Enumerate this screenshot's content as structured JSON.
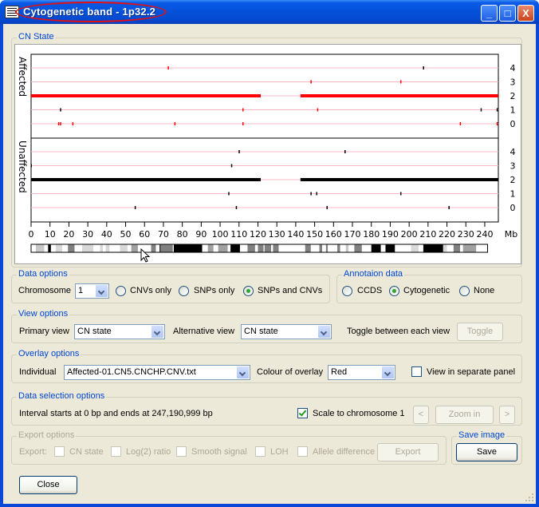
{
  "window": {
    "title": "Cytogenetic band - 1p32.2",
    "controls": {
      "minimize": "_",
      "maximize": "□",
      "close": "X"
    }
  },
  "cn_state_group": {
    "legend": "CN State",
    "panel_labels": [
      "Affected",
      "Unaffected"
    ],
    "level_labels": [
      "4",
      "3",
      "2",
      "1",
      "0"
    ],
    "x_unit": "Mb"
  },
  "chart_data": {
    "type": "scatter",
    "title": "CN State",
    "xlabel": "Mb",
    "ylabel": "CN state",
    "xlim": [
      0,
      247.19
    ],
    "ylim": [
      0,
      4
    ],
    "x_ticks": [
      0,
      10,
      20,
      30,
      40,
      50,
      60,
      70,
      80,
      90,
      100,
      110,
      120,
      130,
      140,
      150,
      160,
      170,
      180,
      190,
      200,
      210,
      220,
      230,
      240
    ],
    "y_ticks": [
      0,
      1,
      2,
      3,
      4
    ],
    "grid": true,
    "panels": [
      {
        "name": "Affected",
        "color": "#ff0000",
        "segments": [
          {
            "state": 2,
            "start": 0,
            "end": 121.5
          },
          {
            "state": 2,
            "start": 142.5,
            "end": 247.19
          }
        ],
        "points": [
          {
            "x": 72.5,
            "state": 4,
            "color": "#ff0000"
          },
          {
            "x": 207.5,
            "state": 4,
            "color": "#000000"
          },
          {
            "x": 148,
            "state": 3,
            "color": "#ff0000"
          },
          {
            "x": 195.5,
            "state": 3,
            "color": "#ff0000"
          },
          {
            "x": 15.5,
            "state": 1,
            "color": "#000000"
          },
          {
            "x": 112,
            "state": 1,
            "color": "#ff0000"
          },
          {
            "x": 151.5,
            "state": 1,
            "color": "#ff0000"
          },
          {
            "x": 238,
            "state": 1,
            "color": "#000000"
          },
          {
            "x": 246.5,
            "state": 1,
            "color": "#000000"
          },
          {
            "x": 14.5,
            "state": 0,
            "color": "#ff0000"
          },
          {
            "x": 15.5,
            "state": 0,
            "color": "#ff0000"
          },
          {
            "x": 22,
            "state": 0,
            "color": "#ff0000"
          },
          {
            "x": 76,
            "state": 0,
            "color": "#ff0000"
          },
          {
            "x": 112,
            "state": 0,
            "color": "#ff0000"
          },
          {
            "x": 227,
            "state": 0,
            "color": "#ff0000"
          },
          {
            "x": 246.5,
            "state": 0,
            "color": "#ff0000"
          }
        ]
      },
      {
        "name": "Unaffected",
        "color": "#000000",
        "segments": [
          {
            "state": 2,
            "start": 0,
            "end": 121.5
          },
          {
            "state": 2,
            "start": 142.5,
            "end": 247.19
          }
        ],
        "points": [
          {
            "x": 110,
            "state": 4,
            "color": "#000000"
          },
          {
            "x": 166,
            "state": 4,
            "color": "#000000"
          },
          {
            "x": 0,
            "state": 3,
            "color": "#000000"
          },
          {
            "x": 106,
            "state": 3,
            "color": "#000000"
          },
          {
            "x": 104.5,
            "state": 1,
            "color": "#000000"
          },
          {
            "x": 148,
            "state": 1,
            "color": "#000000"
          },
          {
            "x": 151,
            "state": 1,
            "color": "#000000"
          },
          {
            "x": 195.5,
            "state": 1,
            "color": "#000000"
          },
          {
            "x": 55,
            "state": 0,
            "color": "#000000"
          },
          {
            "x": 108.5,
            "state": 0,
            "color": "#000000"
          },
          {
            "x": 156.5,
            "state": 0,
            "color": "#000000"
          },
          {
            "x": 221,
            "state": 0,
            "color": "#000000"
          }
        ]
      }
    ],
    "ideogram_bands": [
      {
        "start": 0,
        "end": 2.5,
        "color": "#ffffff"
      },
      {
        "start": 2.5,
        "end": 7,
        "color": "#c8c8c8"
      },
      {
        "start": 7,
        "end": 9,
        "color": "#ffffff"
      },
      {
        "start": 9,
        "end": 10.5,
        "color": "#000000"
      },
      {
        "start": 10.5,
        "end": 13,
        "color": "#ffffff"
      },
      {
        "start": 13,
        "end": 16.5,
        "color": "#d8d8d8"
      },
      {
        "start": 16.5,
        "end": 19.5,
        "color": "#ffffff"
      },
      {
        "start": 19.5,
        "end": 23,
        "color": "#808080"
      },
      {
        "start": 23,
        "end": 27,
        "color": "#ffffff"
      },
      {
        "start": 27,
        "end": 33,
        "color": "#d8d8d8"
      },
      {
        "start": 33,
        "end": 36.5,
        "color": "#ffffff"
      },
      {
        "start": 36.5,
        "end": 38,
        "color": "#d8d8d8"
      },
      {
        "start": 38,
        "end": 39.5,
        "color": "#ffffff"
      },
      {
        "start": 39.5,
        "end": 41.5,
        "color": "#d8d8d8"
      },
      {
        "start": 41.5,
        "end": 47,
        "color": "#ffffff"
      },
      {
        "start": 47,
        "end": 51,
        "color": "#d8d8d8"
      },
      {
        "start": 51,
        "end": 53,
        "color": "#ffffff"
      },
      {
        "start": 53,
        "end": 56.5,
        "color": "#a0a0a0"
      },
      {
        "start": 56.5,
        "end": 63.5,
        "color": "#ffffff"
      },
      {
        "start": 63.5,
        "end": 66,
        "color": "#808080"
      },
      {
        "start": 66,
        "end": 68,
        "color": "#ffffff"
      },
      {
        "start": 68,
        "end": 68.5,
        "color": "#000000"
      },
      {
        "start": 68.5,
        "end": 75,
        "color": "#808080"
      },
      {
        "start": 75,
        "end": 75.5,
        "color": "#ffffff"
      },
      {
        "start": 75.5,
        "end": 90.5,
        "color": "#000000"
      },
      {
        "start": 90.5,
        "end": 93.5,
        "color": "#ffffff"
      },
      {
        "start": 93.5,
        "end": 96.5,
        "color": "#a0a0a0"
      },
      {
        "start": 96.5,
        "end": 99,
        "color": "#ffffff"
      },
      {
        "start": 99,
        "end": 104,
        "color": "#a0a0a0"
      },
      {
        "start": 104,
        "end": 105.5,
        "color": "#ffffff"
      },
      {
        "start": 105.5,
        "end": 110.5,
        "color": "#000000"
      },
      {
        "start": 110.5,
        "end": 114.5,
        "color": "#ffffff"
      },
      {
        "start": 114.5,
        "end": 118.5,
        "color": "#808080"
      },
      {
        "start": 118.5,
        "end": 120,
        "color": "#ffffff"
      },
      {
        "start": 120,
        "end": 123,
        "color": "#808080"
      },
      {
        "start": 123,
        "end": 123.5,
        "color": "#ffffff"
      },
      {
        "start": 123.5,
        "end": 127,
        "color": "#808080"
      },
      {
        "start": 127,
        "end": 128,
        "color": "#ffffff"
      },
      {
        "start": 128,
        "end": 131,
        "color": "#808080"
      },
      {
        "start": 131,
        "end": 144,
        "color": "#ffffff"
      },
      {
        "start": 144,
        "end": 145,
        "color": "#ffffff"
      },
      {
        "start": 145,
        "end": 148,
        "color": "#808080"
      },
      {
        "start": 148,
        "end": 152.5,
        "color": "#ffffff"
      },
      {
        "start": 152.5,
        "end": 154,
        "color": "#808080"
      },
      {
        "start": 154,
        "end": 156,
        "color": "#ffffff"
      },
      {
        "start": 156,
        "end": 157,
        "color": "#808080"
      },
      {
        "start": 157,
        "end": 162,
        "color": "#ffffff"
      },
      {
        "start": 162,
        "end": 163.5,
        "color": "#808080"
      },
      {
        "start": 163.5,
        "end": 166.5,
        "color": "#ffffff"
      },
      {
        "start": 166.5,
        "end": 168,
        "color": "#c8c8c8"
      },
      {
        "start": 168,
        "end": 171,
        "color": "#ffffff"
      },
      {
        "start": 171,
        "end": 175,
        "color": "#808080"
      },
      {
        "start": 175,
        "end": 180,
        "color": "#ffffff"
      },
      {
        "start": 180,
        "end": 185,
        "color": "#000000"
      },
      {
        "start": 185,
        "end": 187.5,
        "color": "#ffffff"
      },
      {
        "start": 187.5,
        "end": 192.5,
        "color": "#000000"
      },
      {
        "start": 192.5,
        "end": 201,
        "color": "#ffffff"
      },
      {
        "start": 201,
        "end": 205,
        "color": "#d8d8d8"
      },
      {
        "start": 205,
        "end": 207.5,
        "color": "#ffffff"
      },
      {
        "start": 207.5,
        "end": 218,
        "color": "#000000"
      },
      {
        "start": 218,
        "end": 220,
        "color": "#d8d8d8"
      },
      {
        "start": 220,
        "end": 223.5,
        "color": "#ffffff"
      },
      {
        "start": 223.5,
        "end": 227,
        "color": "#808080"
      },
      {
        "start": 227,
        "end": 228.5,
        "color": "#ffffff"
      },
      {
        "start": 228.5,
        "end": 235.5,
        "color": "#a0a0a0"
      },
      {
        "start": 235.5,
        "end": 241.5,
        "color": "#ffffff"
      }
    ]
  },
  "data_options": {
    "legend": "Data options",
    "chromosome_label": "Chromosome",
    "chromosome_value": "1",
    "radios": [
      {
        "label": "CNVs only",
        "checked": false
      },
      {
        "label": "SNPs only",
        "checked": false
      },
      {
        "label": "SNPs and CNVs",
        "checked": true
      }
    ]
  },
  "annotation_data": {
    "legend": "Annotaion data",
    "radios": [
      {
        "label": "CCDS",
        "checked": false
      },
      {
        "label": "Cytogenetic",
        "checked": true
      },
      {
        "label": "None",
        "checked": false
      }
    ]
  },
  "view_options": {
    "legend": "View options",
    "primary_label": "Primary view",
    "primary_value": "CN state",
    "alternative_label": "Alternative view",
    "alternative_value": "CN state",
    "toggle_label": "Toggle between each view",
    "toggle_button": "Toggle"
  },
  "overlay_options": {
    "legend": "Overlay options",
    "individual_label": "Individual",
    "individual_value": "Affected-01.CN5.CNCHP.CNV.txt",
    "colour_label": "Colour of overlay",
    "colour_value": "Red",
    "separate_panel_label": "View in separate panel",
    "separate_panel_checked": false
  },
  "data_selection": {
    "legend": "Data selection options",
    "interval_text": "Interval starts at 0 bp and ends at 247,190,999 bp",
    "scale_label": "Scale to chromosome 1",
    "scale_checked": true,
    "prev_button": "<",
    "zoom_button": "Zoom in",
    "next_button": ">"
  },
  "export_options": {
    "legend": "Export options",
    "export_label": "Export:",
    "checks": [
      {
        "label": "CN state"
      },
      {
        "label": "Log(2) ratio"
      },
      {
        "label": "Smooth signal"
      },
      {
        "label": "LOH"
      },
      {
        "label": "Allele difference"
      }
    ],
    "export_button": "Export"
  },
  "save_image": {
    "legend": "Save image",
    "save_button": "Save"
  },
  "close_button": "Close"
}
